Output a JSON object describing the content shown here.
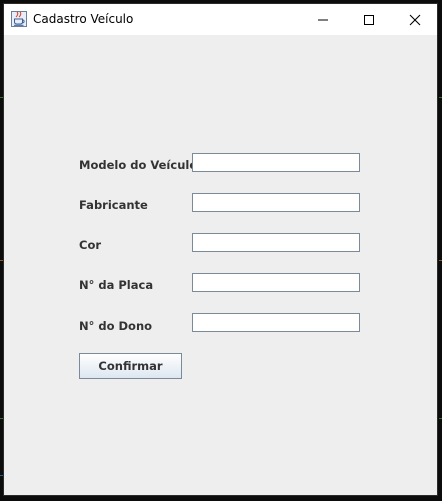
{
  "window": {
    "title": "Cadastro Veículo",
    "icon": "java-cup-icon",
    "controls": {
      "minimize_icon": "minimize-icon",
      "maximize_icon": "maximize-icon",
      "close_icon": "close-icon"
    }
  },
  "form": {
    "fields": [
      {
        "label": "Modelo do Veículo",
        "value": ""
      },
      {
        "label": "Fabricante",
        "value": ""
      },
      {
        "label": "Cor",
        "value": ""
      },
      {
        "label": "N° da Placa",
        "value": ""
      },
      {
        "label": "N° do Dono",
        "value": ""
      }
    ],
    "confirm_label": "Confirmar"
  },
  "colors": {
    "window_background": "#eeeeee",
    "title_bar": "#ffffff",
    "label_text": "#333333",
    "field_border": "#7a8a99"
  }
}
